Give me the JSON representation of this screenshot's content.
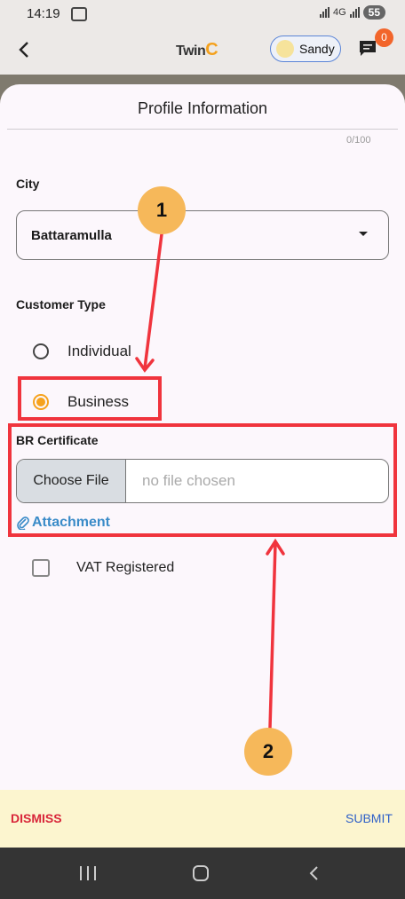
{
  "status_bar": {
    "time": "14:19",
    "battery": "55",
    "network": "4G"
  },
  "header": {
    "logo": "Twin",
    "logo_suffix": "C",
    "user_name": "Sandy",
    "chat_badge": "0"
  },
  "sheet": {
    "title": "Profile Information",
    "counter": "0/100",
    "city": {
      "label": "City",
      "value": "Battaramulla"
    },
    "customer_type": {
      "label": "Customer Type",
      "options": [
        {
          "label": "Individual",
          "selected": false
        },
        {
          "label": "Business",
          "selected": true
        }
      ]
    },
    "br_certificate": {
      "label": "BR Certificate",
      "choose_button": "Choose File",
      "file_status": "no file chosen",
      "attachment_link": "Attachment"
    },
    "vat": {
      "label": "VAT Registered",
      "checked": false
    }
  },
  "annotations": {
    "marker_1": "1",
    "marker_2": "2"
  },
  "footer": {
    "dismiss": "DISMISS",
    "submit": "SUBMIT"
  },
  "colors": {
    "accent": "#f6a21d",
    "annotation_red": "#f0343d",
    "link": "#3a8bc8",
    "dismiss": "#d8263a",
    "submit": "#2d5fc8"
  }
}
